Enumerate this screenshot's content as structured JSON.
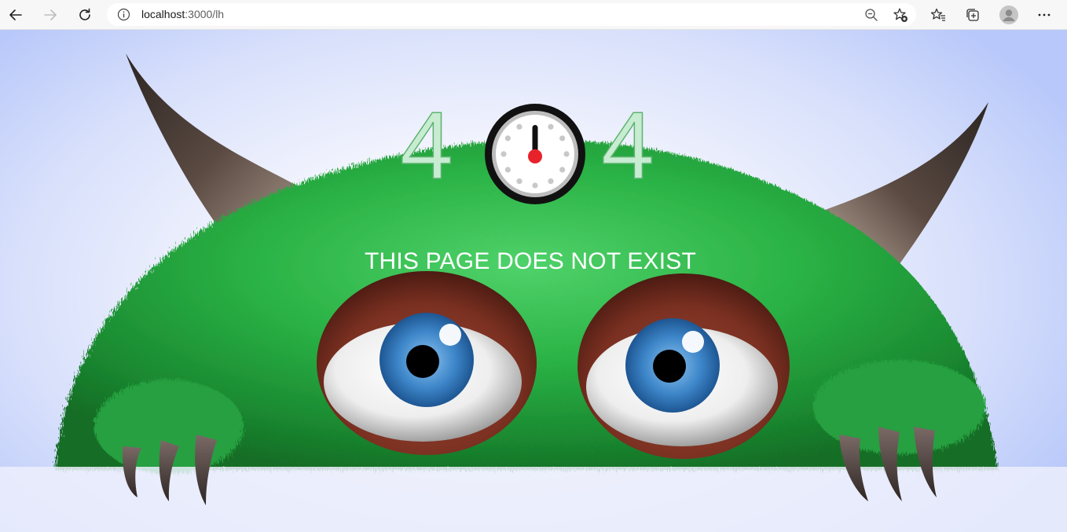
{
  "browser": {
    "url_host": "localhost",
    "url_rest": ":3000/lh",
    "icons": {
      "back": "back-arrow-icon",
      "forward": "forward-arrow-icon",
      "refresh": "refresh-icon",
      "info": "site-info-icon",
      "zoom": "zoom-out-icon",
      "add_favorite": "add-favorite-icon",
      "favorites": "favorites-icon",
      "collections": "collections-icon",
      "profile": "profile-avatar-icon",
      "menu": "more-menu-icon"
    }
  },
  "page": {
    "error_left_digit": "4",
    "error_right_digit": "4",
    "message": "THIS PAGE DOES NOT EXIST",
    "colors": {
      "fur": "#2aa845",
      "digit_fill": "#c7ecd2",
      "clock_hand": "#111111",
      "clock_center": "#e8222b"
    }
  }
}
